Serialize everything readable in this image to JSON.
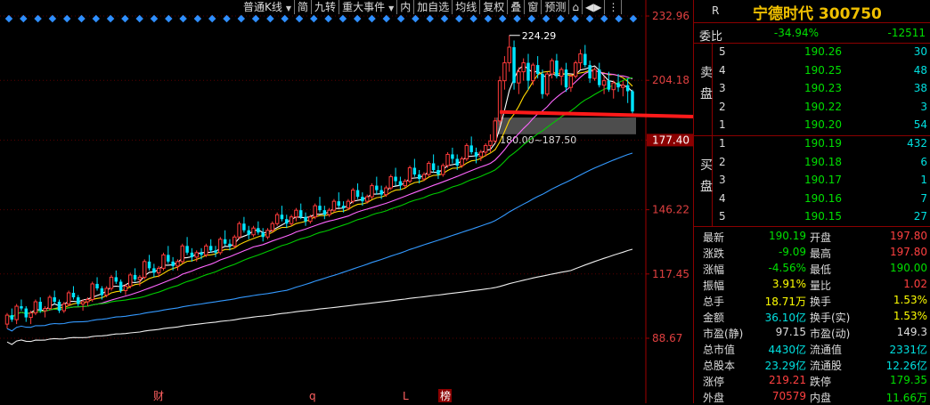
{
  "toolbar": [
    {
      "label": "普通K线",
      "dropdown": true
    },
    {
      "label": "简"
    },
    {
      "label": "九转"
    },
    {
      "label": "重大事件",
      "dropdown": true
    },
    {
      "label": "内"
    },
    {
      "label": "加自选"
    },
    {
      "label": "均线"
    },
    {
      "label": "复权"
    },
    {
      "label": "叠"
    },
    {
      "label": "窗"
    },
    {
      "label": "预测"
    },
    {
      "label": "⌂"
    },
    {
      "label": "◀▶"
    },
    {
      "label": "⋮"
    }
  ],
  "chart_data": {
    "type": "candlestick",
    "ylim": [
      88.67,
      232.96
    ],
    "y_ticks": [
      "232.96",
      "204.18",
      "177.40",
      "146.22",
      "117.45",
      "88.67"
    ],
    "current_price_label": "177.40",
    "high_annotation": "224.29",
    "gap_zone_label": "180.00~187.50",
    "gap_zone": [
      180.0,
      187.5
    ],
    "bottom_markers": [
      "财",
      "q",
      "L",
      "榜"
    ],
    "candles": [
      [
        95,
        100,
        93,
        99
      ],
      [
        99,
        102,
        96,
        97
      ],
      [
        97,
        104,
        95,
        103
      ],
      [
        103,
        106,
        101,
        102
      ],
      [
        102,
        103,
        96,
        98
      ],
      [
        98,
        101,
        95,
        100
      ],
      [
        100,
        106,
        99,
        105
      ],
      [
        105,
        107,
        100,
        101
      ],
      [
        101,
        103,
        98,
        102
      ],
      [
        102,
        108,
        101,
        107
      ],
      [
        107,
        110,
        104,
        105
      ],
      [
        105,
        106,
        100,
        101
      ],
      [
        101,
        105,
        100,
        104
      ],
      [
        104,
        110,
        103,
        109
      ],
      [
        109,
        112,
        106,
        107
      ],
      [
        107,
        108,
        103,
        104
      ],
      [
        104,
        106,
        101,
        105
      ],
      [
        105,
        107,
        103,
        106
      ],
      [
        106,
        114,
        105,
        113
      ],
      [
        113,
        116,
        110,
        111
      ],
      [
        111,
        112,
        106,
        108
      ],
      [
        108,
        112,
        107,
        111
      ],
      [
        111,
        117,
        110,
        116
      ],
      [
        116,
        119,
        113,
        114
      ],
      [
        114,
        115,
        109,
        110
      ],
      [
        110,
        113,
        108,
        112
      ],
      [
        112,
        118,
        111,
        117
      ],
      [
        117,
        120,
        114,
        115
      ],
      [
        115,
        117,
        112,
        116
      ],
      [
        116,
        124,
        115,
        123
      ],
      [
        123,
        126,
        119,
        120
      ],
      [
        120,
        122,
        116,
        118
      ],
      [
        118,
        121,
        116,
        120
      ],
      [
        120,
        127,
        119,
        126
      ],
      [
        126,
        130,
        122,
        123
      ],
      [
        123,
        125,
        119,
        121
      ],
      [
        121,
        124,
        119,
        123
      ],
      [
        123,
        131,
        122,
        130
      ],
      [
        130,
        134,
        126,
        127
      ],
      [
        127,
        129,
        123,
        125
      ],
      [
        125,
        128,
        123,
        127
      ],
      [
        127,
        129,
        124,
        126
      ],
      [
        126,
        131,
        125,
        130
      ],
      [
        130,
        133,
        127,
        128
      ],
      [
        128,
        130,
        125,
        127
      ],
      [
        127,
        134,
        126,
        133
      ],
      [
        133,
        137,
        130,
        131
      ],
      [
        131,
        133,
        128,
        130
      ],
      [
        130,
        135,
        129,
        134
      ],
      [
        134,
        141,
        133,
        140
      ],
      [
        140,
        143,
        136,
        137
      ],
      [
        137,
        139,
        133,
        135
      ],
      [
        135,
        139,
        134,
        138
      ],
      [
        138,
        141,
        135,
        136
      ],
      [
        136,
        138,
        132,
        134
      ],
      [
        134,
        138,
        133,
        137
      ],
      [
        137,
        141,
        136,
        140
      ],
      [
        140,
        145,
        139,
        144
      ],
      [
        144,
        148,
        141,
        142
      ],
      [
        142,
        144,
        138,
        140
      ],
      [
        140,
        144,
        139,
        143
      ],
      [
        143,
        147,
        141,
        146
      ],
      [
        146,
        149,
        142,
        143
      ],
      [
        143,
        145,
        139,
        141
      ],
      [
        141,
        144,
        140,
        143
      ],
      [
        143,
        149,
        142,
        148
      ],
      [
        148,
        152,
        145,
        146
      ],
      [
        146,
        148,
        142,
        144
      ],
      [
        144,
        147,
        143,
        146
      ],
      [
        146,
        151,
        145,
        150
      ],
      [
        150,
        154,
        147,
        148
      ],
      [
        148,
        150,
        145,
        147
      ],
      [
        147,
        151,
        146,
        150
      ],
      [
        150,
        156,
        149,
        155
      ],
      [
        155,
        158,
        151,
        152
      ],
      [
        152,
        154,
        148,
        150
      ],
      [
        150,
        153,
        149,
        152
      ],
      [
        152,
        158,
        151,
        157
      ],
      [
        157,
        161,
        153,
        155
      ],
      [
        155,
        157,
        151,
        153
      ],
      [
        153,
        157,
        152,
        156
      ],
      [
        156,
        162,
        155,
        161
      ],
      [
        161,
        165,
        157,
        159
      ],
      [
        159,
        161,
        155,
        157
      ],
      [
        157,
        160,
        156,
        159
      ],
      [
        159,
        166,
        158,
        165
      ],
      [
        165,
        169,
        161,
        162
      ],
      [
        162,
        164,
        158,
        160
      ],
      [
        160,
        163,
        159,
        162
      ],
      [
        162,
        168,
        161,
        167
      ],
      [
        167,
        171,
        163,
        164
      ],
      [
        164,
        166,
        160,
        162
      ],
      [
        162,
        167,
        161,
        166
      ],
      [
        166,
        172,
        165,
        171
      ],
      [
        171,
        174,
        167,
        169
      ],
      [
        169,
        171,
        164,
        166
      ],
      [
        166,
        170,
        165,
        169
      ],
      [
        169,
        176,
        168,
        175
      ],
      [
        175,
        179,
        171,
        172
      ],
      [
        172,
        174,
        167,
        170
      ],
      [
        170,
        173,
        168,
        172
      ],
      [
        172,
        176,
        170,
        175
      ],
      [
        175,
        180,
        172,
        177
      ],
      [
        177,
        187.5,
        176,
        186
      ],
      [
        186,
        206,
        184,
        204
      ],
      [
        204,
        215,
        200,
        212
      ],
      [
        212,
        224.29,
        208,
        219
      ],
      [
        219,
        222,
        200,
        203
      ],
      [
        203,
        210,
        198,
        208
      ],
      [
        208,
        214,
        204,
        212
      ],
      [
        212,
        216,
        200,
        204
      ],
      [
        204,
        212,
        202,
        211
      ],
      [
        211,
        215,
        205,
        207
      ],
      [
        207,
        209,
        196,
        198
      ],
      [
        198,
        208,
        197,
        207
      ],
      [
        207,
        214,
        205,
        213
      ],
      [
        213,
        216,
        205,
        206
      ],
      [
        206,
        210,
        202,
        209
      ],
      [
        209,
        212,
        199,
        201
      ],
      [
        201,
        207,
        199,
        206
      ],
      [
        206,
        213,
        205,
        212
      ],
      [
        212,
        218,
        209,
        216
      ],
      [
        216,
        220,
        210,
        211
      ],
      [
        211,
        213,
        203,
        205
      ],
      [
        205,
        210,
        204,
        209
      ],
      [
        209,
        212,
        201,
        202
      ],
      [
        202,
        206,
        198,
        204
      ],
      [
        204,
        208,
        199,
        200
      ],
      [
        200,
        204,
        196,
        203
      ],
      [
        203,
        207,
        199,
        201
      ],
      [
        201,
        204,
        197,
        202
      ],
      [
        202,
        205,
        194,
        199.28
      ],
      [
        199.28,
        200,
        189,
        190.19
      ]
    ],
    "moving_averages": [
      {
        "color": "#ffffff",
        "values_ref": "ma5"
      },
      {
        "color": "#ffd700",
        "values_ref": "ma10"
      },
      {
        "color": "#ff66ff",
        "values_ref": "ma20"
      },
      {
        "color": "#00cc00",
        "values_ref": "ma30"
      },
      {
        "color": "#3399ff",
        "values_ref": "ma60"
      },
      {
        "color": "#eeeeee",
        "values_ref": "ma120"
      }
    ]
  },
  "quote": {
    "r_label": "R",
    "title": "宁德时代 300750",
    "weibi": {
      "label": "委比",
      "pct": "-34.94%",
      "diff": "-12511"
    },
    "sell_label": [
      "卖",
      "盘"
    ],
    "buy_label": [
      "买",
      "盘"
    ],
    "asks": [
      {
        "level": "5",
        "price": "190.26",
        "vol": "30"
      },
      {
        "level": "4",
        "price": "190.25",
        "vol": "48"
      },
      {
        "level": "3",
        "price": "190.23",
        "vol": "38"
      },
      {
        "level": "2",
        "price": "190.22",
        "vol": "3"
      },
      {
        "level": "1",
        "price": "190.20",
        "vol": "54"
      }
    ],
    "bids": [
      {
        "level": "1",
        "price": "190.19",
        "vol": "432"
      },
      {
        "level": "2",
        "price": "190.18",
        "vol": "6"
      },
      {
        "level": "3",
        "price": "190.17",
        "vol": "1"
      },
      {
        "level": "4",
        "price": "190.16",
        "vol": "7"
      },
      {
        "level": "5",
        "price": "190.15",
        "vol": "27"
      }
    ],
    "stats": [
      {
        "l1": "最新",
        "v1": "190.19",
        "c1": "#00e000",
        "l2": "开盘",
        "v2": "197.80",
        "c2": "#ff4040"
      },
      {
        "l1": "涨跌",
        "v1": "-9.09",
        "c1": "#00e000",
        "l2": "最高",
        "v2": "197.80",
        "c2": "#ff4040"
      },
      {
        "l1": "涨幅",
        "v1": "-4.56%",
        "c1": "#00e000",
        "l2": "最低",
        "v2": "190.00",
        "c2": "#00e000"
      },
      {
        "l1": "振幅",
        "v1": "3.91%",
        "c1": "#ffff00",
        "l2": "量比",
        "v2": "1.02",
        "c2": "#ff4040"
      },
      {
        "l1": "总手",
        "v1": "18.71万",
        "c1": "#ffff00",
        "l2": "换手",
        "v2": "1.53%",
        "c2": "#ffff00"
      },
      {
        "l1": "金额",
        "v1": "36.10亿",
        "c1": "#00e0e0",
        "l2": "换手(实)",
        "v2": "1.53%",
        "c2": "#ffff00"
      },
      {
        "l1": "市盈(静)",
        "v1": "97.15",
        "c1": "#dddddd",
        "l2": "市盈(动)",
        "v2": "149.3",
        "c2": "#dddddd"
      },
      {
        "l1": "总市值",
        "v1": "4430亿",
        "c1": "#00e0e0",
        "l2": "流通值",
        "v2": "2331亿",
        "c2": "#00e0e0"
      },
      {
        "l1": "总股本",
        "v1": "23.29亿",
        "c1": "#00e0e0",
        "l2": "流通股",
        "v2": "12.26亿",
        "c2": "#00e0e0"
      },
      {
        "l1": "涨停",
        "v1": "219.21",
        "c1": "#ff4040",
        "l2": "跌停",
        "v2": "179.35",
        "c2": "#00e000"
      },
      {
        "l1": "外盘",
        "v1": "70579",
        "c1": "#ff4040",
        "l2": "内盘",
        "v2": "11.66万",
        "c2": "#00e000"
      }
    ]
  }
}
